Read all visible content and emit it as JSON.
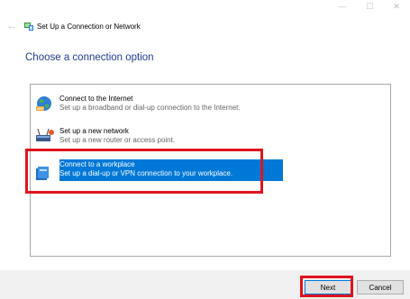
{
  "window": {
    "title": "Set Up a Connection or Network",
    "controls": {
      "minimize": "—",
      "maximize": "☐",
      "close": "✕"
    },
    "back": "←"
  },
  "heading": "Choose a connection option",
  "options": [
    {
      "title": "Connect to the Internet",
      "description": "Set up a broadband or dial-up connection to the Internet.",
      "icon": "globe-icon",
      "selected": false
    },
    {
      "title": "Set up a new network",
      "description": "Set up a new router or access point.",
      "icon": "router-icon",
      "selected": false
    },
    {
      "title": "Connect to a workplace",
      "description": "Set up a dial-up or VPN connection to your workplace.",
      "icon": "workplace-icon",
      "selected": true
    }
  ],
  "buttons": {
    "next": "Next",
    "cancel": "Cancel"
  },
  "colors": {
    "heading": "#1e3d8f",
    "selection": "#0078d7",
    "annotation": "#e0141e",
    "footer": "#f0f0f0"
  }
}
